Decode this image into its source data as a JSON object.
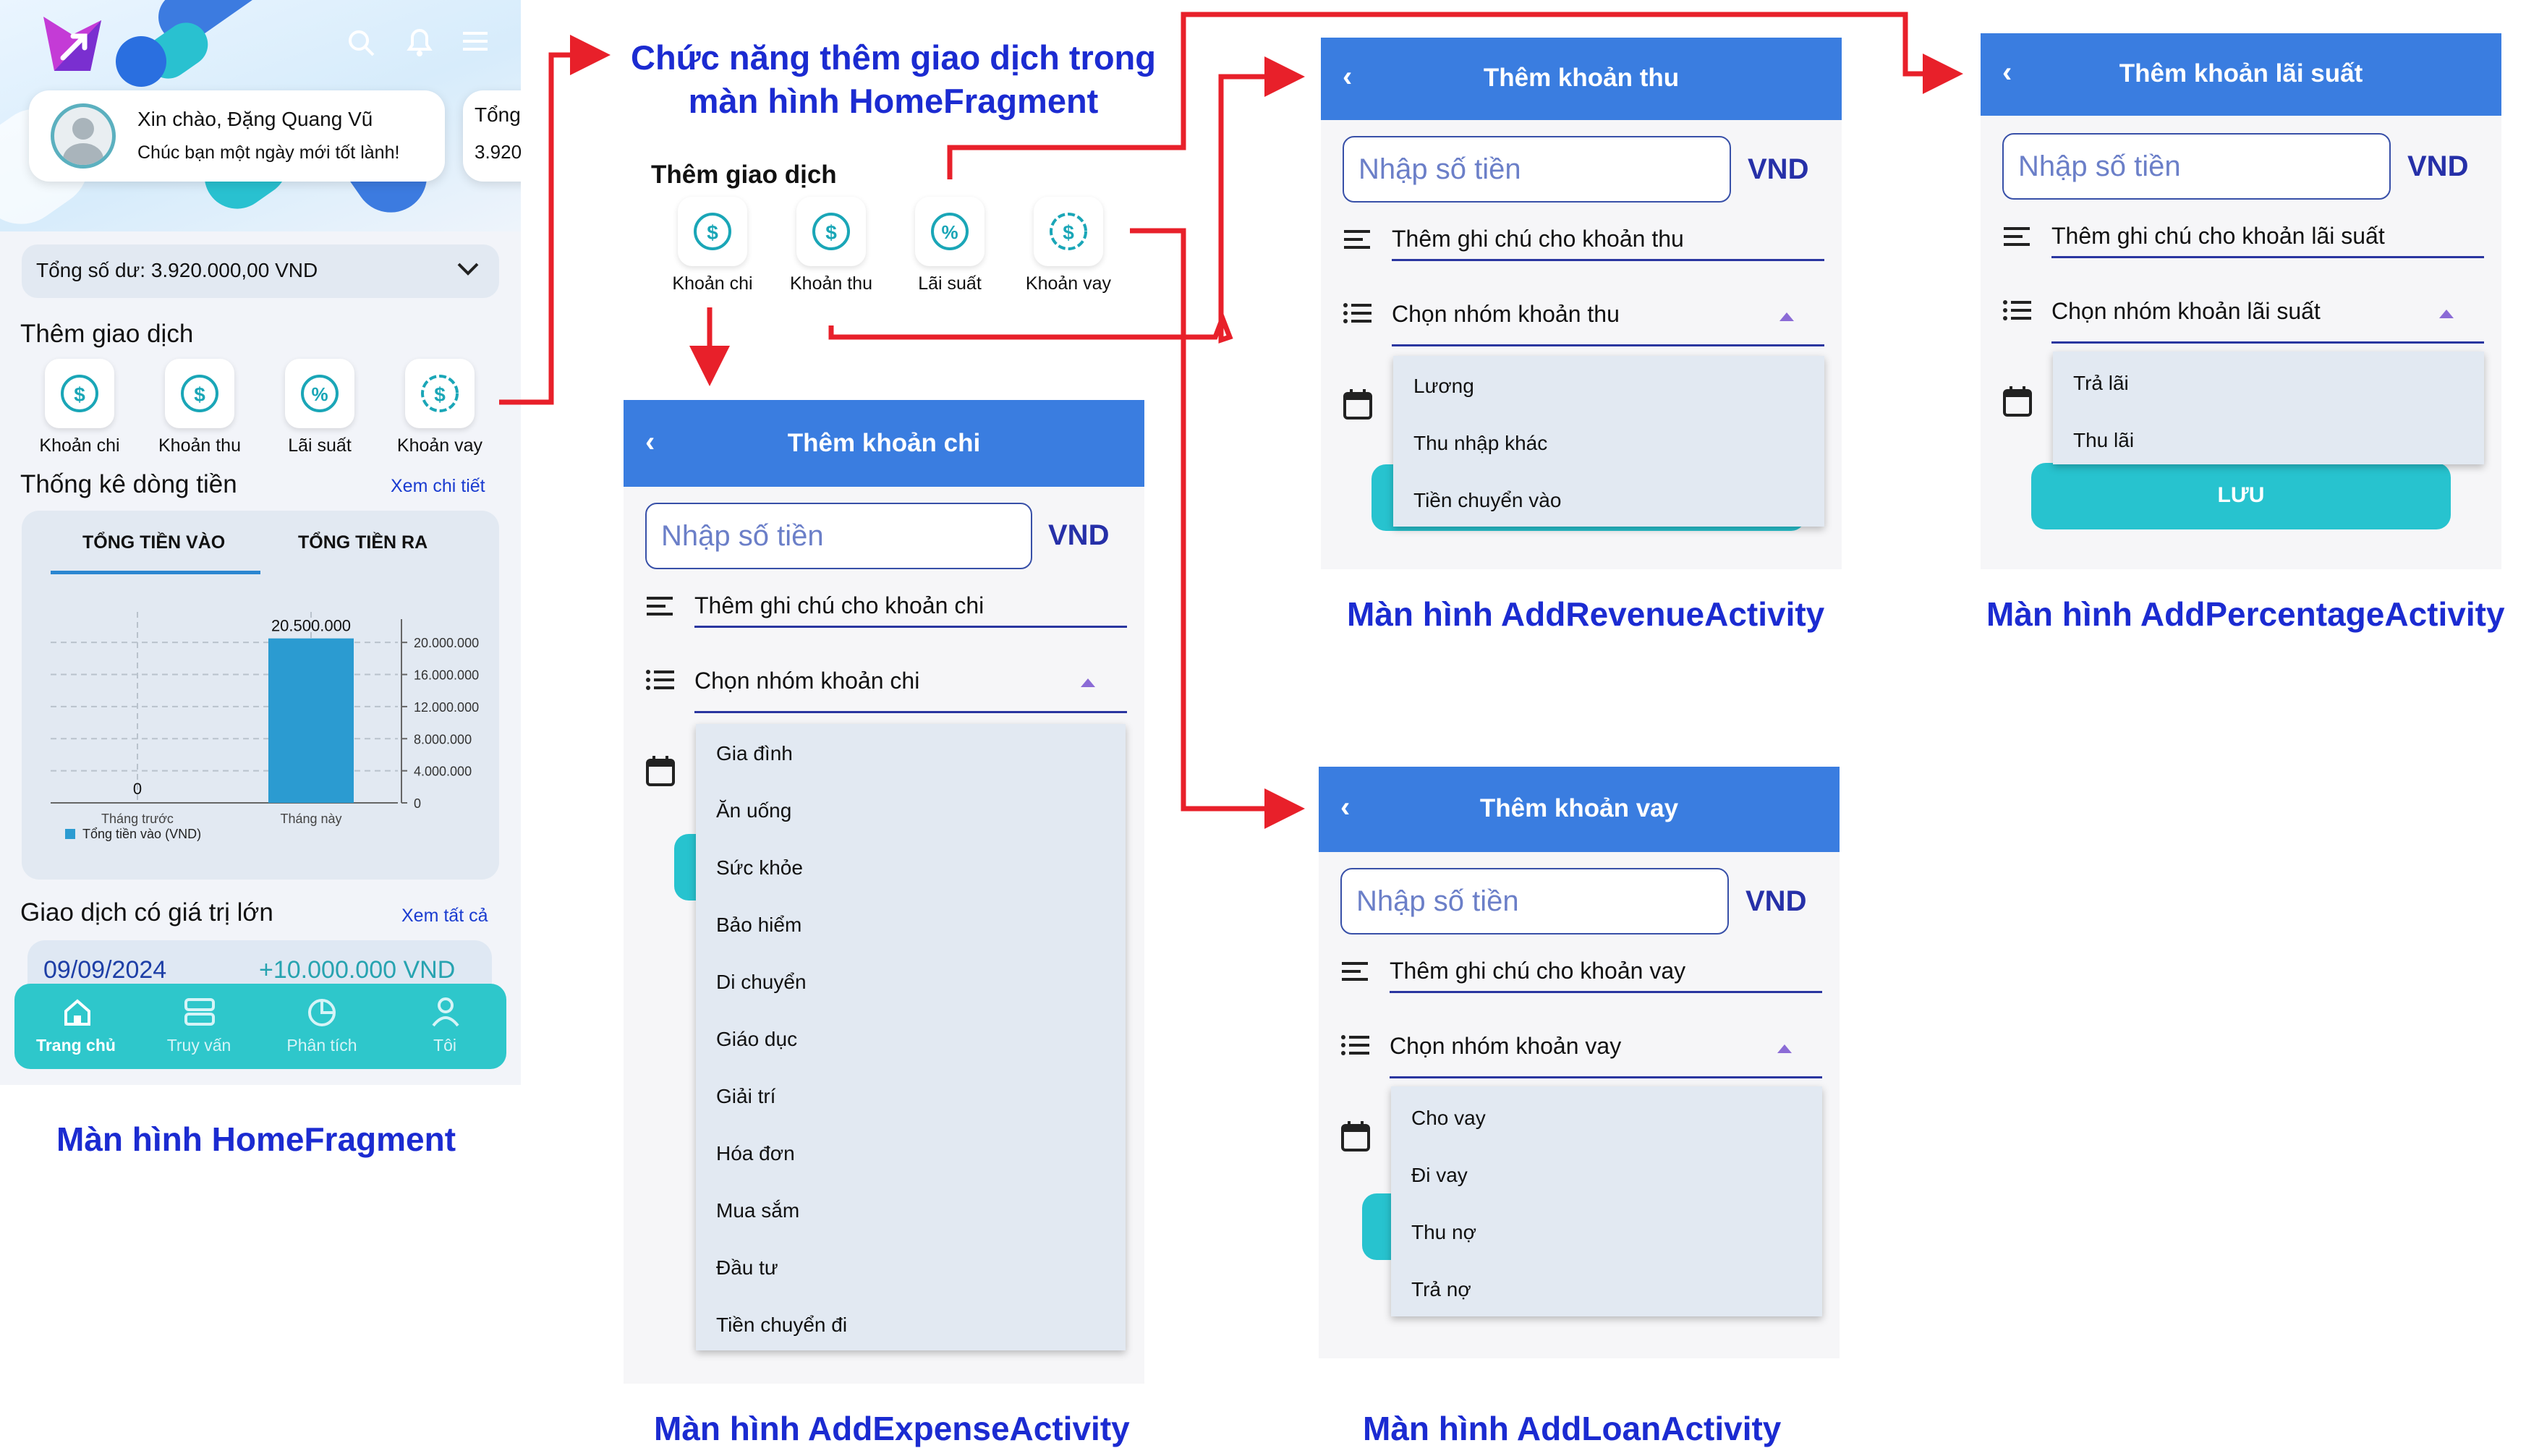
{
  "home": {
    "greeting": "Xin chào, Đặng Quang Vũ",
    "wish": "Chúc bạn một ngày mới tốt lành!",
    "peek_title": "Tổng",
    "peek_value": "3.920",
    "balance": "Tổng số dư: 3.920.000,00 VND",
    "add_title": "Thêm giao dịch",
    "actions": [
      "Khoản chi",
      "Khoản thu",
      "Lãi suất",
      "Khoản vay"
    ],
    "stats_title": "Thống kê dòng tiền",
    "stats_link": "Xem chi tiết",
    "tab_in": "TỔNG TIỀN VÀO",
    "tab_out": "TỔNG TIỀN RA",
    "big_title": "Giao dịch có giá trị lớn",
    "big_link": "Xem tất cả",
    "big_date": "09/09/2024",
    "big_amount": "+10.000.000 VND",
    "nav": [
      "Trang chủ",
      "Truy vấn",
      "Phân tích",
      "Tôi"
    ],
    "caption": "Màn hình HomeFragment"
  },
  "chart_data": {
    "type": "bar",
    "categories": [
      "Tháng trước",
      "Tháng này"
    ],
    "series": [
      {
        "name": "Tổng tiền vào (VND)",
        "values": [
          0,
          20500000
        ]
      }
    ],
    "data_labels": [
      "0",
      "20.500.000"
    ],
    "yticks": [
      "20.000.000",
      "16.000.000",
      "12.000.000",
      "8.000.000",
      "4.000.000",
      "0"
    ],
    "ylim": [
      0,
      22000000
    ],
    "y_axis_side": "right",
    "grid": true,
    "legend": "bottom-left",
    "bar_color": "#2b9bd1"
  },
  "flow": {
    "title_line1": "Chức năng thêm giao dịch trong",
    "title_line2": "màn hình HomeFragment",
    "add_title": "Thêm giao dịch",
    "actions": [
      "Khoản chi",
      "Khoản thu",
      "Lãi suất",
      "Khoản vay"
    ]
  },
  "expense": {
    "title": "Thêm khoản chi",
    "placeholder": "Nhập số tiền",
    "currency": "VND",
    "note": "Thêm ghi chú cho khoản chi",
    "group": "Chọn nhóm khoản chi",
    "options": [
      "Gia đình",
      "Ăn uống",
      "Sức khỏe",
      "Bảo hiểm",
      "Di chuyển",
      "Giáo dục",
      "Giải trí",
      "Hóa đơn",
      "Mua sắm",
      "Đầu tư",
      "Tiền chuyển đi"
    ],
    "caption": "Màn hình AddExpenseActivity"
  },
  "revenue": {
    "title": "Thêm khoản thu",
    "placeholder": "Nhập số tiền",
    "currency": "VND",
    "note": "Thêm ghi chú cho khoản thu",
    "group": "Chọn nhóm khoản thu",
    "options": [
      "Lương",
      "Thu nhập khác",
      "Tiền chuyển vào"
    ],
    "caption": "Màn hình AddRevenueActivity"
  },
  "percentage": {
    "title": "Thêm khoản lãi suất",
    "placeholder": "Nhập số tiền",
    "currency": "VND",
    "note": "Thêm ghi chú cho khoản lãi suất",
    "group": "Chọn nhóm khoản lãi suất",
    "options": [
      "Trả lãi",
      "Thu lãi"
    ],
    "save": "LƯU",
    "caption": "Màn hình AddPercentageActivity"
  },
  "loan": {
    "title": "Thêm khoản vay",
    "placeholder": "Nhập số tiền",
    "currency": "VND",
    "note": "Thêm ghi chú cho khoản vay",
    "group": "Chọn nhóm khoản vay",
    "options": [
      "Cho vay",
      "Đi vay",
      "Thu nợ",
      "Trả nợ"
    ],
    "caption": "Màn hình AddLoanActivity"
  },
  "colors": {
    "arrow": "#e8202a",
    "caption": "#1b2bd1",
    "appbar": "#3a7de0",
    "teal": "#27c3cf"
  }
}
